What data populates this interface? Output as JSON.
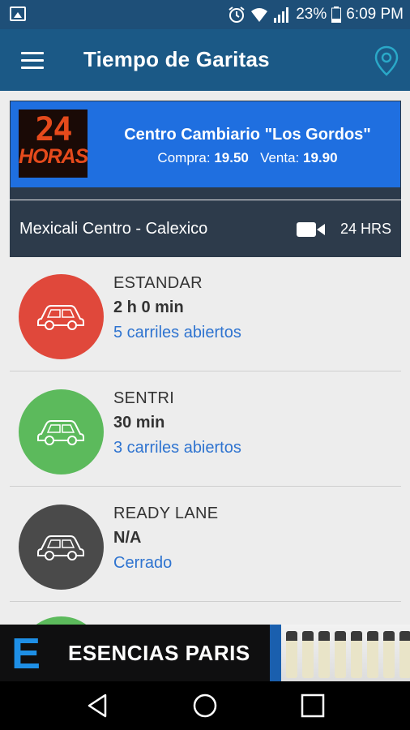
{
  "status_bar": {
    "battery_percent": "23%",
    "time": "6:09 PM",
    "icons": [
      "image-icon",
      "alarm-icon",
      "wifi-icon",
      "signal-icon",
      "battery-icon"
    ]
  },
  "app_bar": {
    "title": "Tiempo de Garitas",
    "menu_icon": "menu-icon",
    "location_icon": "location-pin-icon"
  },
  "promo": {
    "logo_number": "24",
    "logo_text": "HORAS",
    "name": "Centro Cambiario \"Los Gordos\"",
    "buy_label": "Compra:",
    "buy_value": "19.50",
    "sell_label": "Venta:",
    "sell_value": "19.90"
  },
  "crossing": {
    "name": "Mexicali Centro - Calexico",
    "camera_icon": "video-camera-icon",
    "hours": "24 HRS"
  },
  "lanes": [
    {
      "type": "ESTANDAR",
      "time": "2 h 0 min",
      "status": "5 carriles abiertos",
      "color": "#e0483b"
    },
    {
      "type": "SENTRI",
      "time": "30 min",
      "status": "3 carriles abiertos",
      "color": "#5cba5c"
    },
    {
      "type": "READY LANE",
      "time": "N/A",
      "status": "Cerrado",
      "color": "#4a4a4a"
    }
  ],
  "ad": {
    "logo_letter": "E",
    "text": "ESENCIAS PARIS"
  },
  "nav": {
    "back": "back-icon",
    "home": "home-icon",
    "recents": "recents-icon"
  },
  "colors": {
    "status_bar": "#1e4f78",
    "app_bar": "#1b5986",
    "promo": "#1f6fe0",
    "crossing": "#2d3b4b",
    "link": "#2f74d0",
    "pin": "#2aa8c8"
  }
}
